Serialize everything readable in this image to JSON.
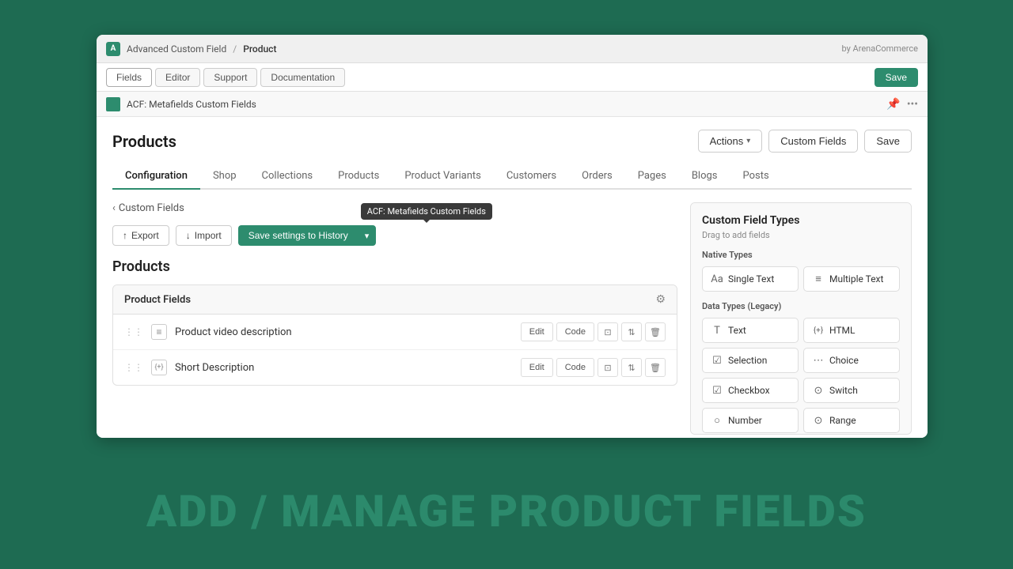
{
  "browser": {
    "breadcrumb_app": "Advanced Custom Field",
    "breadcrumb_sep": "/",
    "breadcrumb_current": "Product",
    "by_label": "by ArenaCommerce"
  },
  "nav_tabs": {
    "items": [
      {
        "label": "Fields",
        "active": true
      },
      {
        "label": "Editor",
        "active": false
      },
      {
        "label": "Support",
        "active": false
      },
      {
        "label": "Documentation",
        "active": false
      }
    ],
    "save_label": "Save"
  },
  "sub_bar": {
    "title": "ACF: Metafields Custom Fields",
    "icon1": "📌",
    "icon2": "•••"
  },
  "page_header": {
    "title": "Products",
    "actions_label": "Actions",
    "custom_fields_label": "Custom Fields",
    "save_label": "Save"
  },
  "tab_nav": {
    "items": [
      {
        "label": "Configuration",
        "active": true
      },
      {
        "label": "Shop",
        "active": false
      },
      {
        "label": "Collections",
        "active": false
      },
      {
        "label": "Products",
        "active": false
      },
      {
        "label": "Product Variants",
        "active": false
      },
      {
        "label": "Customers",
        "active": false
      },
      {
        "label": "Orders",
        "active": false
      },
      {
        "label": "Pages",
        "active": false
      },
      {
        "label": "Blogs",
        "active": false
      },
      {
        "label": "Posts",
        "active": false
      }
    ]
  },
  "back_link": {
    "label": "Custom Fields"
  },
  "toolbar": {
    "export_label": "Export",
    "import_label": "Import",
    "save_history_label": "Save settings to History",
    "tooltip_text": "ACF: Metafields Custom Fields"
  },
  "section": {
    "title": "Products",
    "card_title": "Product Fields",
    "fields": [
      {
        "name": "Product video description",
        "type_icon": "≡",
        "edit_label": "Edit",
        "code_label": "Code"
      },
      {
        "name": "Short Description",
        "type_icon": "{+}",
        "edit_label": "Edit",
        "code_label": "Code"
      }
    ]
  },
  "right_panel": {
    "title": "Custom Field Types",
    "subtitle": "Drag to add fields",
    "native_types_label": "Native Types",
    "native_types": [
      {
        "label": "Single Text",
        "icon": "Aa"
      },
      {
        "label": "Multiple Text",
        "icon": "≡"
      }
    ],
    "legacy_label": "Data Types (Legacy)",
    "legacy_types": [
      {
        "label": "Text",
        "icon": "T"
      },
      {
        "label": "HTML",
        "icon": "{+}"
      },
      {
        "label": "Selection",
        "icon": "☑"
      },
      {
        "label": "Choice",
        "icon": "⋯"
      },
      {
        "label": "Checkbox",
        "icon": "☑"
      },
      {
        "label": "Switch",
        "icon": "⊙"
      },
      {
        "label": "Number",
        "icon": "○"
      },
      {
        "label": "Range",
        "icon": "⊙"
      }
    ]
  },
  "bottom_text": "ADD / MANAGE PRODUCT FIELDS"
}
